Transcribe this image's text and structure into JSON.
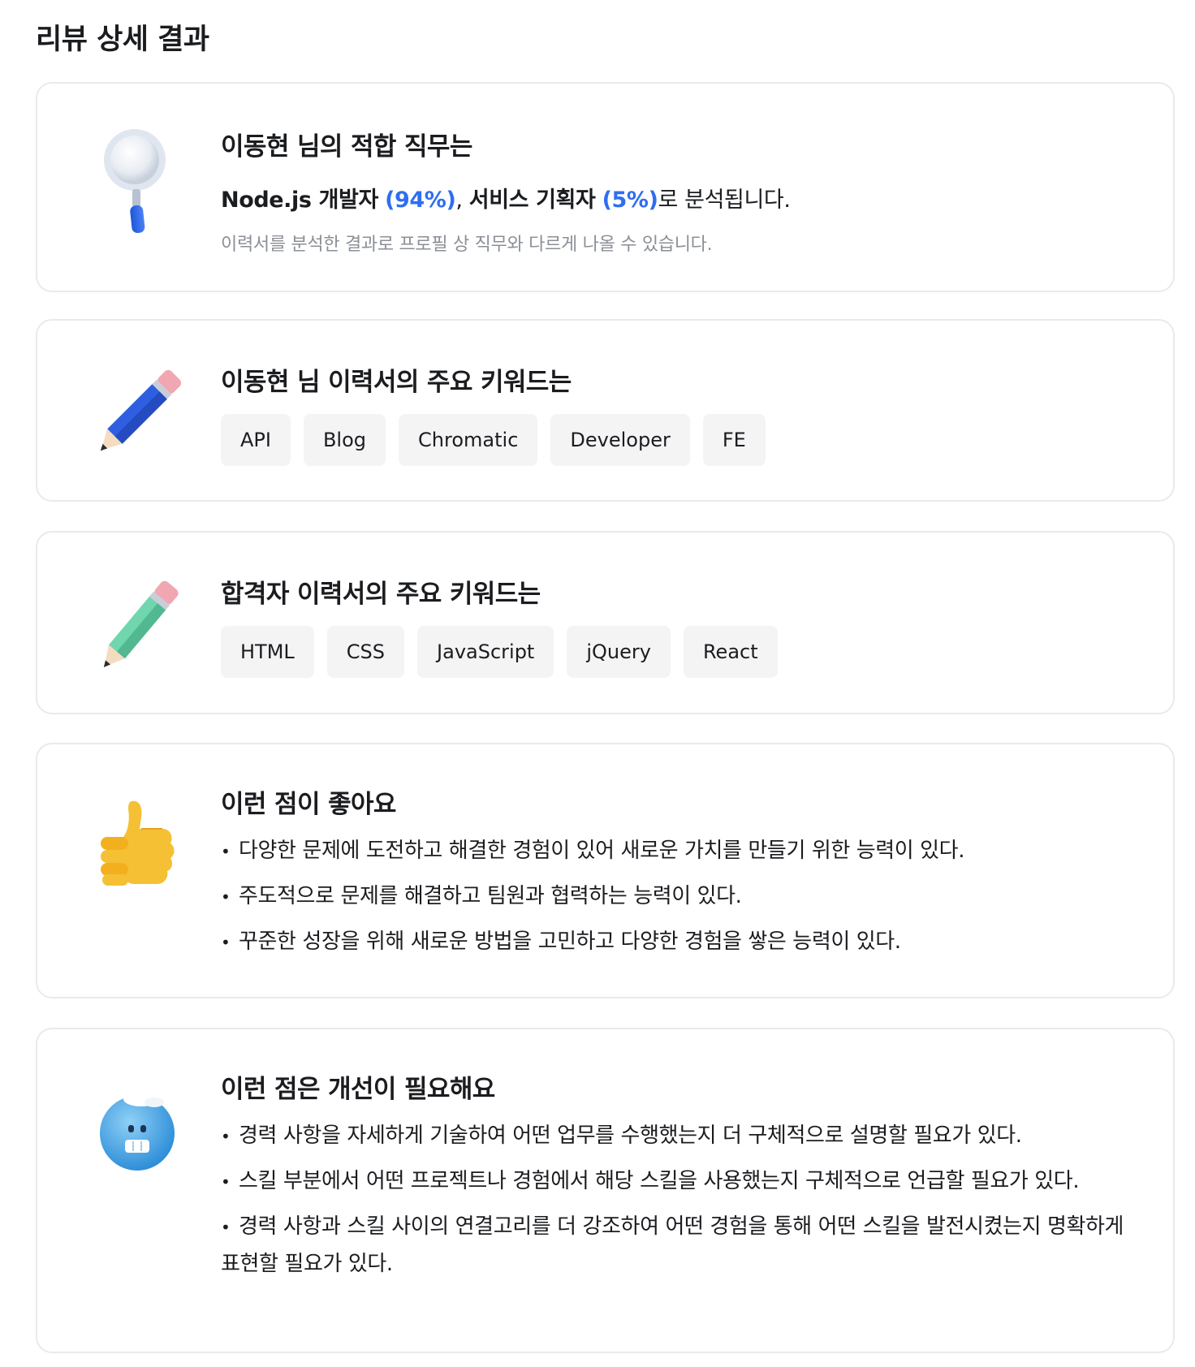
{
  "page": {
    "title": "리뷰 상세 결과"
  },
  "job_fit": {
    "title": "이동현 님의 적합 직무는",
    "job1": "Node.js 개발자",
    "job1_pct": "(94%)",
    "sep": ",",
    "job2": "서비스 기획자",
    "job2_pct": "(5%)",
    "suffix": "로 분석됩니다.",
    "note": "이력서를 분석한 결과로 프로필 상 직무와 다르게 나올 수 있습니다.",
    "icon": "magnifier-icon"
  },
  "my_keywords": {
    "title": "이동현 님 이력서의 주요 키워드는",
    "tags": [
      "API",
      "Blog",
      "Chromatic",
      "Developer",
      "FE"
    ],
    "icon": "blue-pencil-icon"
  },
  "passer_keywords": {
    "title": "합격자 이력서의 주요 키워드는",
    "tags": [
      "HTML",
      "CSS",
      "JavaScript",
      "jQuery",
      "React"
    ],
    "icon": "green-pencil-icon"
  },
  "strengths": {
    "title": "이런 점이 좋아요",
    "items": [
      "다양한 문제에 도전하고 해결한 경험이 있어 새로운 가치를 만들기 위한 능력이 있다.",
      "주도적으로 문제를 해결하고 팀원과 협력하는 능력이 있다.",
      "꾸준한 성장을 위해 새로운 방법을 고민하고 다양한 경험을 쌓은 능력이 있다."
    ],
    "icon": "thumbs-up-icon"
  },
  "improvements": {
    "title": "이런 점은 개선이 필요해요",
    "items": [
      "경력 사항을 자세하게 기술하여 어떤 업무를 수행했는지 더 구체적으로 설명할 필요가 있다.",
      "스킬 부분에서 어떤 프로젝트나 경험에서 해당 스킬을 사용했는지 구체적으로 언급할 필요가 있다.",
      "경력 사항과 스킬 사이의 연결고리를 더 강조하여 어떤 경험을 통해 어떤 스킬을 발전시켰는지 명확하게 표현할 필요가 있다."
    ],
    "icon": "cold-face-icon"
  },
  "colors": {
    "accent": "#2f6ef0",
    "border": "#e8eaed",
    "tag_bg": "#f4f4f5",
    "muted": "#8b8f96"
  }
}
